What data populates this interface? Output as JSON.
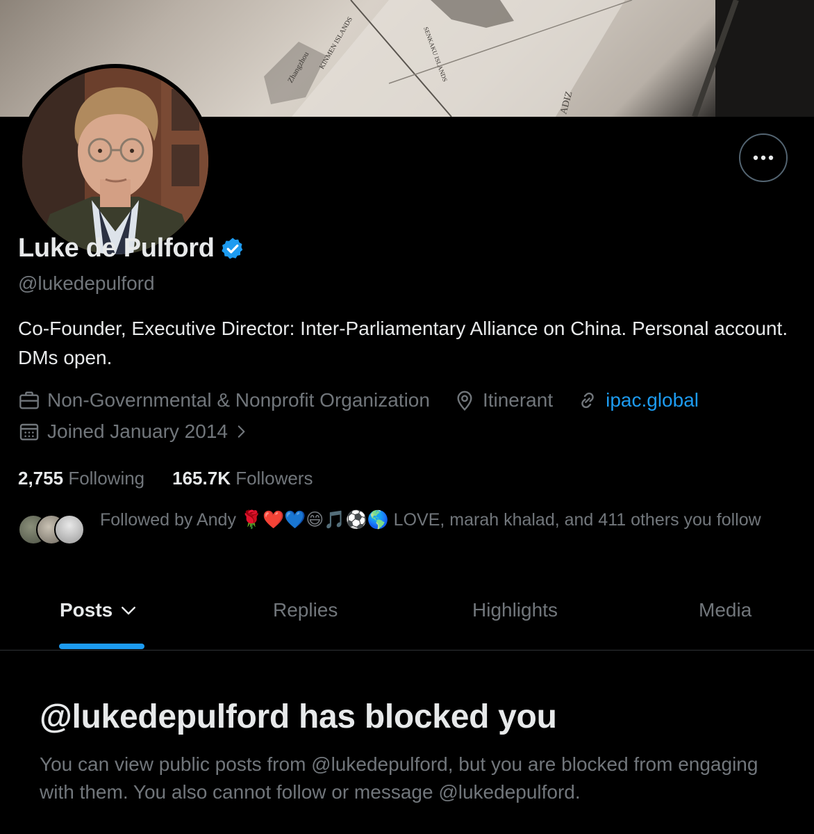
{
  "profile": {
    "display_name": "Luke de Pulford",
    "handle": "@lukedepulford",
    "bio": "Co-Founder, Executive Director: Inter-Parliamentary Alliance on China. Personal account. DMs open.",
    "category": "Non-Governmental & Nonprofit Organization",
    "location": "Itinerant",
    "website": "ipac.global",
    "joined": "Joined January 2014",
    "following_count": "2,755",
    "following_label": "Following",
    "followers_count": "165.7K",
    "followers_label": "Followers",
    "followed_by": "Followed by Andy 🌹❤️💙😄🎵⚽🌎 LOVE, marah khalad, and 411 others you follow"
  },
  "banner": {
    "map_labels": [
      "KINMEN ISLANDS",
      "Zhangzhou",
      "SENKAKU ISLANDS",
      "ADIZ"
    ]
  },
  "tabs": [
    {
      "label": "Posts",
      "active": true
    },
    {
      "label": "Replies",
      "active": false
    },
    {
      "label": "Highlights",
      "active": false
    },
    {
      "label": "Media",
      "active": false
    }
  ],
  "blocked": {
    "title": "@lukedepulford has blocked you",
    "message": "You can view public posts from @lukedepulford, but you are blocked from engaging with them. You also cannot follow or message @lukedepulford."
  },
  "colors": {
    "accent": "#1d9bf0",
    "background": "#000000",
    "secondary_text": "#71767b",
    "primary_text": "#e7e9ea"
  },
  "icons": {
    "more": "more-horizontal-icon",
    "verified": "verified-badge-icon",
    "category": "briefcase-icon",
    "location": "location-pin-icon",
    "website": "link-icon",
    "joined": "calendar-icon",
    "joined_more": "chevron-right-icon",
    "posts_menu": "chevron-down-icon"
  }
}
